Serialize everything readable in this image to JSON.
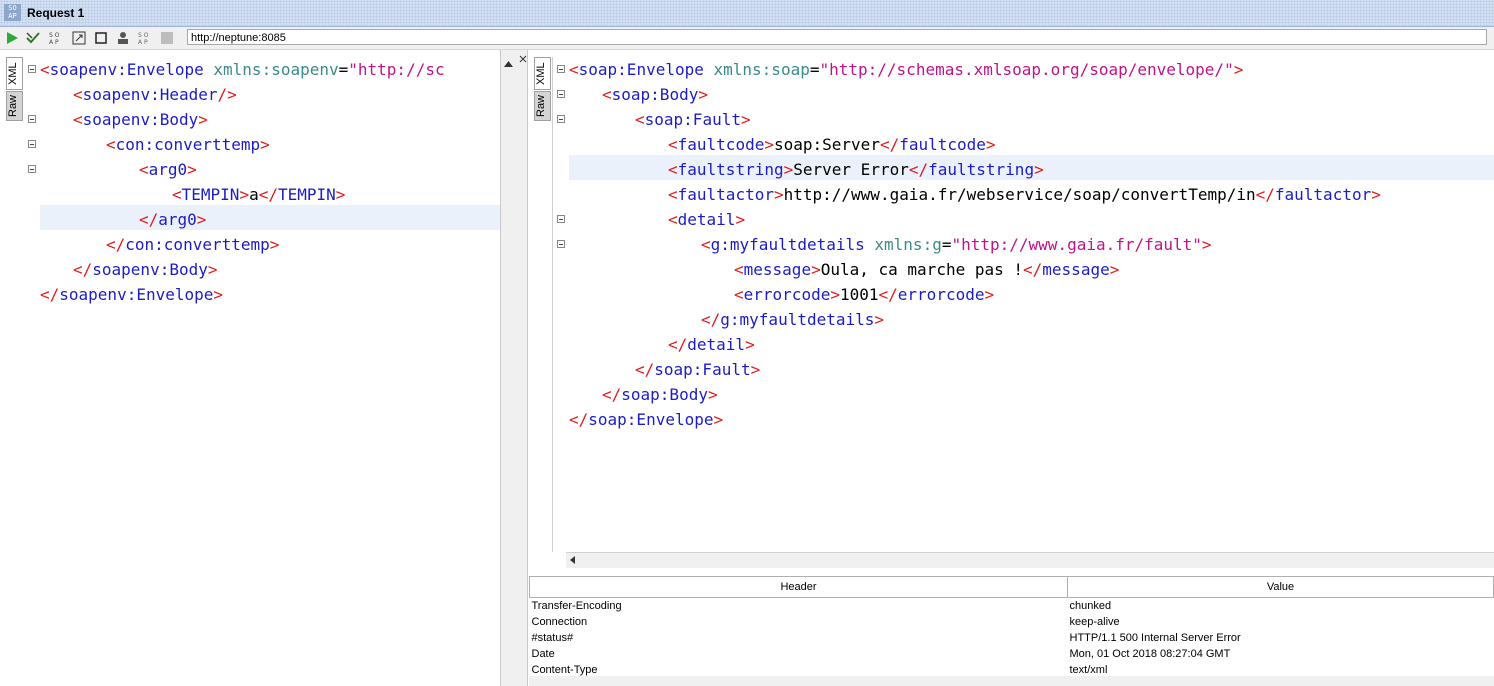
{
  "window": {
    "title": "Request 1",
    "logo": "SO AP"
  },
  "toolbar": {
    "url": "http://neptune:8085",
    "icons": [
      "run-icon",
      "validate-icon",
      "wsa-icon",
      "format-icon",
      "stop-icon",
      "auth-icon",
      "properties-icon",
      "square-icon"
    ]
  },
  "request_tabs": {
    "xml": "XML",
    "raw": "Raw"
  },
  "response_tabs": {
    "xml": "XML",
    "raw": "Raw"
  },
  "request_xml": {
    "l0": {
      "open": "<",
      "name": "soapenv:Envelope",
      "attr": " xmlns:soapenv",
      "eq": "=",
      "val": "\"http://sc"
    },
    "l1": {
      "open": "<",
      "name": "soapenv:Header",
      "close": "/>"
    },
    "l2": {
      "open": "<",
      "name": "soapenv:Body",
      "close": ">"
    },
    "l3": {
      "open": "<",
      "name": "con:converttemp",
      "close": ">"
    },
    "l4": {
      "open": "<",
      "name": "arg0",
      "close": ">"
    },
    "l5": {
      "open": "<",
      "name": "TEMPIN",
      "mid": ">",
      "text": "a",
      "open2": "</",
      "name2": "TEMPIN",
      "close": ">"
    },
    "l6": {
      "open": "</",
      "name": "arg0",
      "close": ">"
    },
    "l7": {
      "open": "</",
      "name": "con:converttemp",
      "close": ">"
    },
    "l8": {
      "open": "</",
      "name": "soapenv:Body",
      "close": ">"
    },
    "l9": {
      "open": "</",
      "name": "soapenv:Envelope",
      "close": ">"
    }
  },
  "response_xml": {
    "l0": {
      "open": "<",
      "name": "soap:Envelope",
      "attr": " xmlns:soap",
      "eq": "=",
      "val": "\"http://schemas.xmlsoap.org/soap/envelope/\"",
      "close": ">"
    },
    "l1": {
      "open": "<",
      "name": "soap:Body",
      "close": ">"
    },
    "l2": {
      "open": "<",
      "name": "soap:Fault",
      "close": ">"
    },
    "l3": {
      "open": "<",
      "name": "faultcode",
      "mid": ">",
      "text": "soap:Server",
      "open2": "</",
      "name2": "faultcode",
      "close": ">"
    },
    "l4": {
      "open": "<",
      "name": "faultstring",
      "mid": ">",
      "text": "Server Error",
      "open2": "</",
      "name2": "faultstring",
      "close": ">"
    },
    "l5": {
      "open": "<",
      "name": "faultactor",
      "mid": ">",
      "text": "http://www.gaia.fr/webservice/soap/convertTemp/in",
      "open2": "</",
      "name2": "faultactor",
      "close": ">"
    },
    "l6": {
      "open": "<",
      "name": "detail",
      "close": ">"
    },
    "l7": {
      "open": "<",
      "name": "g:myfaultdetails",
      "attr": " xmlns:g",
      "eq": "=",
      "val": "\"http://www.gaia.fr/fault\"",
      "close": ">"
    },
    "l8": {
      "open": "<",
      "name": "message",
      "mid": ">",
      "text": "Oula, ca marche pas !",
      "open2": "</",
      "name2": "message",
      "close": ">"
    },
    "l9": {
      "open": "<",
      "name": "errorcode",
      "mid": ">",
      "text": "1001",
      "open2": "</",
      "name2": "errorcode",
      "close": ">"
    },
    "l10": {
      "open": "</",
      "name": "g:myfaultdetails",
      "close": ">"
    },
    "l11": {
      "open": "</",
      "name": "detail",
      "close": ">"
    },
    "l12": {
      "open": "</",
      "name": "soap:Fault",
      "close": ">"
    },
    "l13": {
      "open": "</",
      "name": "soap:Body",
      "close": ">"
    },
    "l14": {
      "open": "</",
      "name": "soap:Envelope",
      "close": ">"
    }
  },
  "headers_table": {
    "columns": {
      "header": "Header",
      "value": "Value"
    },
    "rows": [
      {
        "header": "Transfer-Encoding",
        "value": "chunked"
      },
      {
        "header": "Connection",
        "value": "keep-alive"
      },
      {
        "header": "#status#",
        "value": "HTTP/1.1 500 Internal Server Error"
      },
      {
        "header": "Date",
        "value": "Mon, 01 Oct 2018 08:27:04 GMT"
      },
      {
        "header": "Content-Type",
        "value": "text/xml"
      }
    ]
  }
}
